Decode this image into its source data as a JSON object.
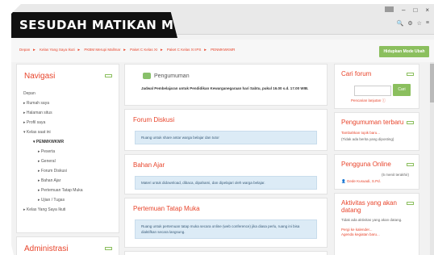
{
  "banner": {
    "title": "SESUDAH MATIKAN MODE UBAH"
  },
  "window": {
    "minimize": "–",
    "maximize": "□",
    "close": "×"
  },
  "address_icons": [
    "🔍",
    "⚙",
    "☆",
    "≡"
  ],
  "breadcrumb": [
    "Depan",
    "Kelas Yang Saya Ikuti",
    "PKBM Merupi Mallmar",
    "Paket C Kelas XI",
    "Paket C Kelas XI IPS",
    "PENMKWKMR"
  ],
  "edit_button": {
    "label": "Hidupkan Mode Ubah"
  },
  "navigation": {
    "title": "Navigasi",
    "items": [
      {
        "label": "Depan",
        "level": 1,
        "bold": false
      },
      {
        "label": "Rumah saya",
        "level": 1,
        "bold": false
      },
      {
        "label": "Halaman situs",
        "level": 1,
        "bold": false
      },
      {
        "label": "Profil saya",
        "level": 1,
        "bold": false
      },
      {
        "label": "Kelas saat ini",
        "level": 1,
        "bold": false
      },
      {
        "label": "PENMKWKMR",
        "level": 2,
        "bold": true
      },
      {
        "label": "Peserta",
        "level": 3,
        "bold": false
      },
      {
        "label": "General",
        "level": 3,
        "bold": false
      },
      {
        "label": "Forum Diskusi",
        "level": 3,
        "bold": false
      },
      {
        "label": "Bahan Ajar",
        "level": 3,
        "bold": false
      },
      {
        "label": "Pertemuan Tatap Muka",
        "level": 3,
        "bold": false
      },
      {
        "label": "Ujian / Tugas",
        "level": 3,
        "bold": false
      },
      {
        "label": "Kelas Yang Saya Ikuti",
        "level": 1,
        "bold": false
      }
    ]
  },
  "administrasi": {
    "title": "Administrasi"
  },
  "announcement": {
    "title": "Pengumuman",
    "text": "Jadwal Pembelajaran untuk Pendidikan Kewarganegaraan hari Sabtu, pukul 16.00 s.d. 17.00 WIB."
  },
  "sections": [
    {
      "title": "Forum Diskusi",
      "note": "Ruang untuk share antar warga belajar dan tutor"
    },
    {
      "title": "Bahan Ajar",
      "note": "Materi untuk didownload, dibaca, dipahami, dan dipelajari oleh warga belajar."
    },
    {
      "title": "Pertemuan Tatap Muka",
      "note": "Ruang untuk pertemuan tatap muka secara online (web conference) jika diasa perlu, ruang ini bisa diaktifkan secara langsung."
    }
  ],
  "right": {
    "search": {
      "title": "Cari forum",
      "button": "Cari",
      "advanced": "Pencarian lanjutan"
    },
    "news": {
      "title": "Pengumuman terbaru",
      "link": "Tambahkan topik baru...",
      "empty": "(Tidak ada berita yang diposting)"
    },
    "online": {
      "title": "Pengguna Online",
      "period": "(5 menit terakhir)",
      "user": "Gede Kusuadi, S.Pd."
    },
    "upcoming": {
      "title": "Aktivitas yang akan datang",
      "empty": "Tidak ada aktivitas yang akan datang.",
      "link1": "Pergi ke kalender...",
      "link2": "Agenda kegiatan baru..."
    }
  }
}
